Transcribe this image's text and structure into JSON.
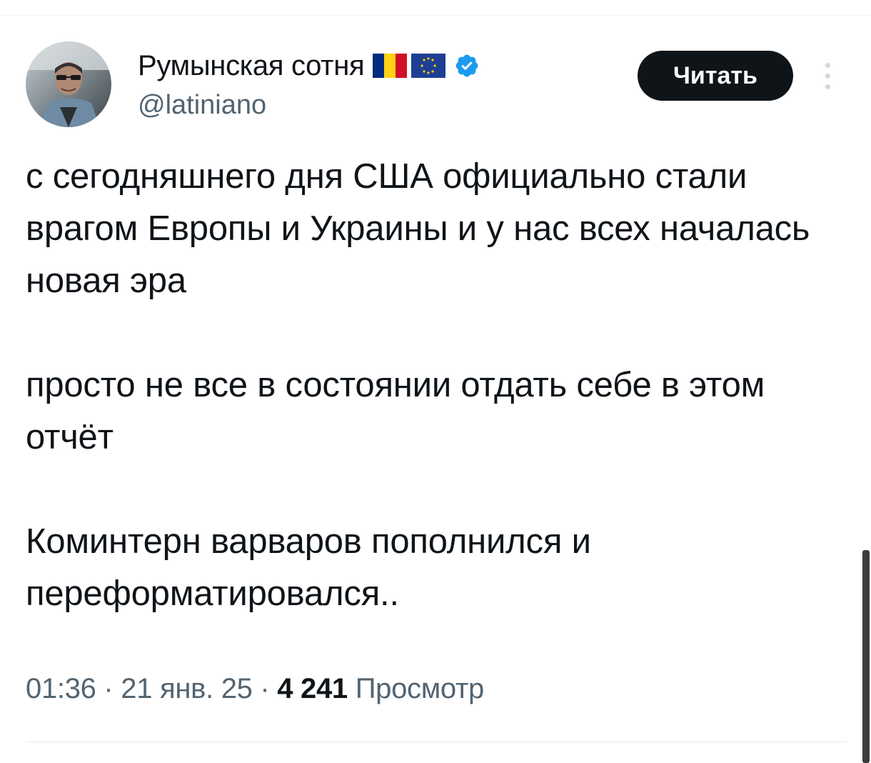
{
  "author": {
    "display_name": "Румынская сотня",
    "handle": "@latiniano",
    "flags": [
      "romania-flag",
      "eu-flag"
    ],
    "verified": true,
    "accent_color": "#1d9bf0"
  },
  "follow_button_label": "Читать",
  "tweet": {
    "paragraphs": [
      "с сегодняшнего дня США официально стали врагом Европы и Украины и у нас всех началась новая эра",
      "просто не все в состоянии отдать себе в этом отчёт",
      "Коминтерн варваров пополнился и переформатировался.."
    ]
  },
  "meta": {
    "time": "01:36",
    "separator": " · ",
    "date": "21 янв. 25",
    "views_count": "4 241",
    "views_label": "Просмотр"
  }
}
